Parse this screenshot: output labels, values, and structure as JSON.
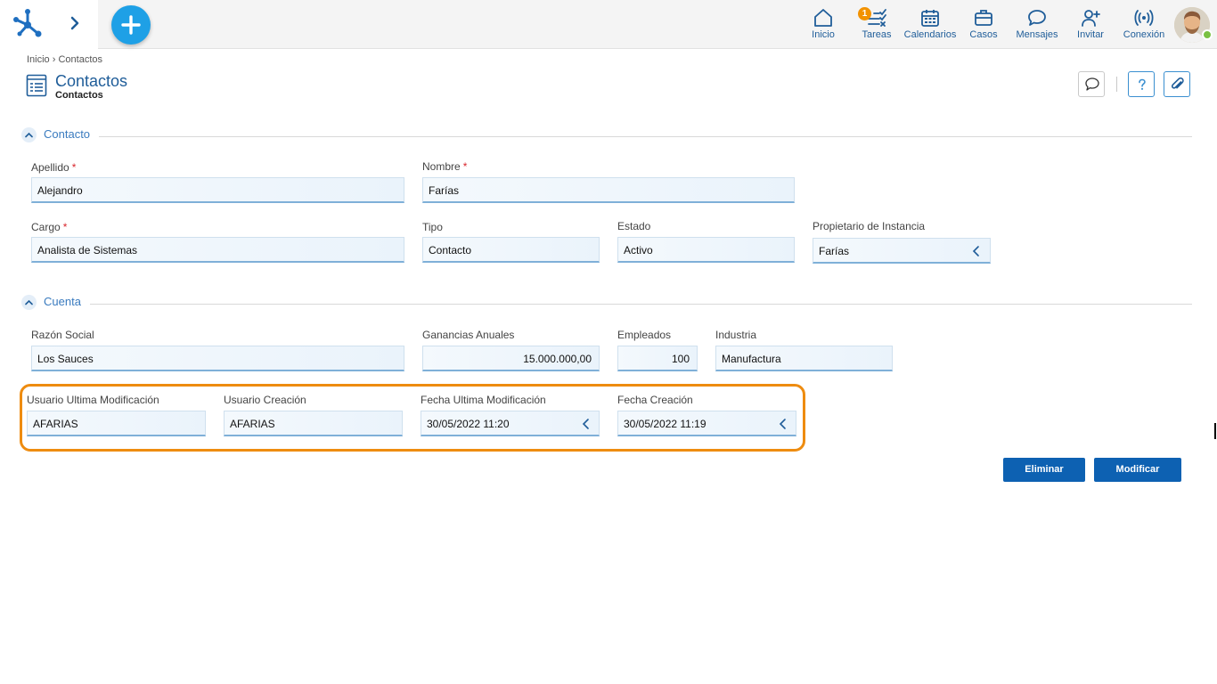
{
  "topbar": {
    "nav": [
      {
        "label": "Inicio",
        "icon": "home-icon"
      },
      {
        "label": "Tareas",
        "icon": "tasks-icon",
        "badge": "1"
      },
      {
        "label": "Calendarios",
        "icon": "calendar-icon"
      },
      {
        "label": "Casos",
        "icon": "briefcase-icon"
      },
      {
        "label": "Mensajes",
        "icon": "chat-icon"
      },
      {
        "label": "Invitar",
        "icon": "add-user-icon"
      },
      {
        "label": "Conexión",
        "icon": "signal-icon"
      }
    ],
    "status_color": "#7ac142"
  },
  "breadcrumb": {
    "home": "Inicio",
    "separator": "›",
    "current": "Contactos"
  },
  "page": {
    "title": "Contactos",
    "subtitle": "Contactos"
  },
  "sections": {
    "contacto": {
      "label": "Contacto",
      "fields": {
        "apellido": {
          "label": "Apellido",
          "value": "Alejandro",
          "required": "*"
        },
        "nombre": {
          "label": "Nombre",
          "value": "Farías",
          "required": "*"
        },
        "cargo": {
          "label": "Cargo",
          "value": "Analista de Sistemas",
          "required": "*"
        },
        "tipo": {
          "label": "Tipo",
          "value": "Contacto"
        },
        "estado": {
          "label": "Estado",
          "value": "Activo"
        },
        "propietario": {
          "label": "Propietario de Instancia",
          "value": "Farías"
        }
      }
    },
    "cuenta": {
      "label": "Cuenta",
      "fields": {
        "razon_social": {
          "label": "Razón Social",
          "value": "Los Sauces"
        },
        "ganancias": {
          "label": "Ganancias Anuales",
          "value": "15.000.000,00"
        },
        "empleados": {
          "label": "Empleados",
          "value": "100"
        },
        "industria": {
          "label": "Industria",
          "value": "Manufactura"
        }
      }
    },
    "auditoria": {
      "usuario_ult_mod": {
        "label": "Usuario Ultima Modificación",
        "value": "AFARIAS"
      },
      "usuario_creacion": {
        "label": "Usuario Creación",
        "value": "AFARIAS"
      },
      "fecha_ult_mod": {
        "label": "Fecha Ultima Modificación",
        "value": "30/05/2022 11:20"
      },
      "fecha_creacion": {
        "label": "Fecha Creación",
        "value": "30/05/2022 11:19"
      }
    }
  },
  "actions": {
    "delete": "Eliminar",
    "modify": "Modificar"
  },
  "colors": {
    "accent": "#1f5d99",
    "fab": "#1ea0e6",
    "button": "#0d61b2",
    "highlight": "#ee8c10",
    "required": "#d8262d"
  }
}
